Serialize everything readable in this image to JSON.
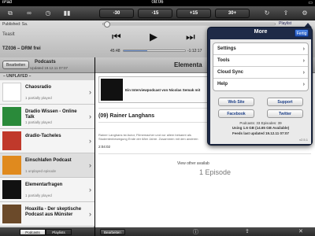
{
  "statusbar": {
    "device": "iPad",
    "time": "08:06",
    "battery": ""
  },
  "toolbar": {
    "skip_back_30": "-30",
    "skip_back_15": "-15",
    "skip_fwd_15": "+15",
    "skip_fwd_30": "30+"
  },
  "player": {
    "published": "Published: Sa.",
    "playlist_label": "Playlist",
    "teaser": "Teaslt",
    "episode_name": "TZ036 – DRM frei",
    "elapsed": "45:48",
    "remaining": "-1:12:17",
    "progress_fraction": 0.38
  },
  "left_panel": {
    "edit_label": "Bearbeiten",
    "title": "Podcasts",
    "subtitle": "Updated 19.12.11 07:07",
    "section": "– UNPLAYED –",
    "items": [
      {
        "title": "Chaosradio",
        "status": "1 partially played"
      },
      {
        "title": "Dradio Wissen - Online Talk",
        "status": "1 partially played"
      },
      {
        "title": "dradio-Tacheles",
        "status": ""
      },
      {
        "title": "Einschlafen Podcast",
        "status": "1 unplayed episode"
      },
      {
        "title": "Elementarfragen",
        "status": "1 partially played"
      },
      {
        "title": "Hoaxilla - Der skeptische Podcast aus Münster",
        "status": ""
      }
    ],
    "tabs": [
      "Podcasts",
      "Playlists"
    ],
    "active_tab": "Podcasts"
  },
  "main": {
    "header_title": "Elementa",
    "card_title": "Ein Interviewpodcast von Nicolas Semak mit",
    "episode_title": "(09) Rainer Langhans",
    "description": "Rainer Langhans ist Autor, Filmemacher und vor allem bekannt als Studentenbewegung Ende der 68er Jahre. Zusammen mit den anderen",
    "duration": "2:04:02",
    "view_other": "View other availab",
    "episode_count": "1 Episode",
    "footer_edit": "Bearbeiten"
  },
  "popover": {
    "title": "More",
    "done": "Fertig",
    "menu": [
      "Settings",
      "Tools",
      "Cloud Sync",
      "Help"
    ],
    "buttons": [
      "Web Site",
      "Support",
      "Facebook",
      "Twitter"
    ],
    "stats_line1": "Podcasts: 33    Episodes: 39",
    "stats_line2": "Using 1.6 GB (14.65 GB Available)",
    "stats_line3": "Feeds last updated 19.12.11 07:07",
    "version": "v2.5.1"
  }
}
